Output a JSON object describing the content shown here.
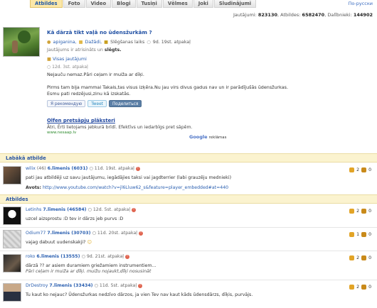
{
  "nav": {
    "tabs": [
      "Atbildes",
      "Foto",
      "Video",
      "Blogi",
      "Tusiņi",
      "Vēlmes",
      "Joki",
      "Sludinājumi"
    ],
    "active": "Atbildes",
    "lang_link": "По-русски"
  },
  "stats": {
    "questions_label": "Jautājumi:",
    "questions": "823130",
    "answers_label": "Atbildes:",
    "answers": "6582470",
    "members_label": "Dalībnieki:",
    "members": "144902"
  },
  "question": {
    "title": "Kā dārzā tikt vaļā no ūdensžurkām ?",
    "author": "apiganina,",
    "category": "Dažādi,",
    "closing": "Slēgšanas laiks",
    "time": "9d. 19st. atpakaļ",
    "status_prefix": "Jautājums ir atrisināts un",
    "status_value": "slēgts.",
    "all_questions": "Visas jautājumi",
    "posted": "12d. 3st. atpakaļ",
    "body_1": "Nejauču nemaz.Pāri ceļam ir muiža ar dīķi.",
    "body_2": "Pirms tam bija mammai Takais,tas visus izķēra.Nu jau virs divus gadus nav un ir parādījušās ūdensžurkas.",
    "body_3": "Esmu pati redzējusi,zinu kā izskatās.",
    "share_fb": "Я рекомендую",
    "share_tw": "Tweet",
    "share_vk": "Поделиться"
  },
  "ad": {
    "title": "Olfen pretsāpju plāksteri",
    "text": "Ātri, Ērti lietojams jebkurā brīdī. Efektīvs un iedarbīgs pret sāpēm.",
    "url": "www.nesaap.lv",
    "google_prefix": "Google",
    "google_suffix": "reklāmas"
  },
  "best": {
    "section": "Labākā atbilde",
    "user": "wilix",
    "user_score": "(46)",
    "level": "6.līmenis (6031)",
    "time": "11d. 19st. atpakaļ",
    "text": "pati jau atbildēji uz savu jautājumu, iegādājies taksi vai jagdterrier (labi grauzēju mednieki)",
    "source_label": "Avots:",
    "source_url": "http://www.youtube.com/watch?v=jl6Lluw62_s&feature=player_embedded#at=440",
    "up": "2",
    "down": "0"
  },
  "answers_section": "Atbildes",
  "answers": [
    {
      "user": "Letinhs",
      "level": "7.līmenis (46584)",
      "time": "12d. 5st. atpakaļ",
      "text": "uzcel aizsprostu :D  tev ir dārzs jeb purvs :D",
      "up": "2",
      "down": "0"
    },
    {
      "user": "Odium77",
      "level": "7.līmenis (30703)",
      "time": "11d. 20st. atpakaļ",
      "text": "vajag dabuut uudenskakji?",
      "up": "1",
      "down": "0"
    },
    {
      "user": "roko",
      "level": "6.līmenis (13555)",
      "time": "9d. 21st. atpakaļ",
      "text": "dārzā ?? ar asiem duramiem griežamiem instrumentiem...",
      "text_2": "Pāri ceļam ir muiža ar dīķi. muižu nojaukt,dīķi nosusināt",
      "up": "2",
      "down": "0"
    },
    {
      "user": "DrDestroy",
      "level": "7.līmenis (33434)",
      "time": "11d. 5st. atpakaļ",
      "text": "Tu kaut ko nejauc? Ūdensžurkas nedzīvo dārzos, ja vien Tev nav kaut kāds ūdensdārzs, dīķis, purvājs.",
      "up": "2",
      "down": "0"
    }
  ]
}
